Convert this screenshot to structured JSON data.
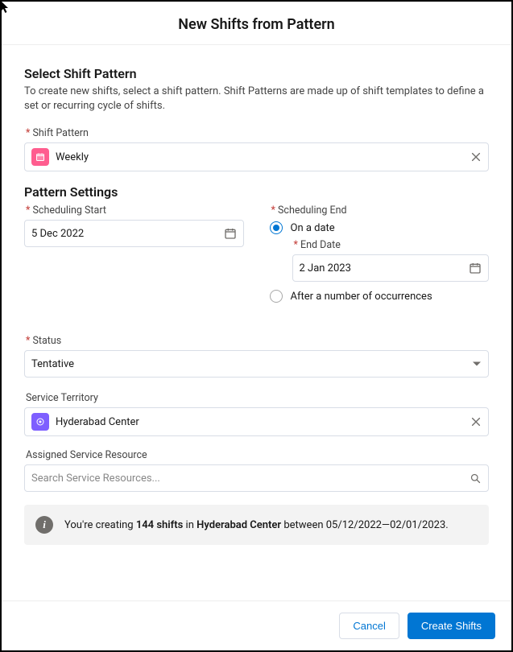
{
  "header": {
    "title": "New Shifts from Pattern"
  },
  "section1": {
    "title": "Select Shift Pattern",
    "helper": "To create new shifts, select a shift pattern. Shift Patterns are made up of shift templates to define a set or recurring cycle of shifts.",
    "shift_pattern_label": "Shift Pattern",
    "shift_pattern_value": "Weekly"
  },
  "section2": {
    "title": "Pattern Settings",
    "sched_start_label": "Scheduling Start",
    "sched_start_value": "5 Dec 2022",
    "sched_end_label": "Scheduling End",
    "radio_on_date": "On a date",
    "end_date_label": "End Date",
    "end_date_value": "2 Jan 2023",
    "radio_after_occ": "After a number of occurrences"
  },
  "status": {
    "label": "Status",
    "value": "Tentative"
  },
  "territory": {
    "label": "Service Territory",
    "value": "Hyderabad Center"
  },
  "resource": {
    "label": "Assigned Service Resource",
    "placeholder": "Search Service Resources..."
  },
  "info": {
    "prefix": "You're creating ",
    "count": "144 shifts",
    "mid1": " in ",
    "center": "Hyderabad Center",
    "mid2": " between ",
    "range": "05/12/2022—02/01/2023."
  },
  "footer": {
    "cancel": "Cancel",
    "create": "Create Shifts"
  }
}
